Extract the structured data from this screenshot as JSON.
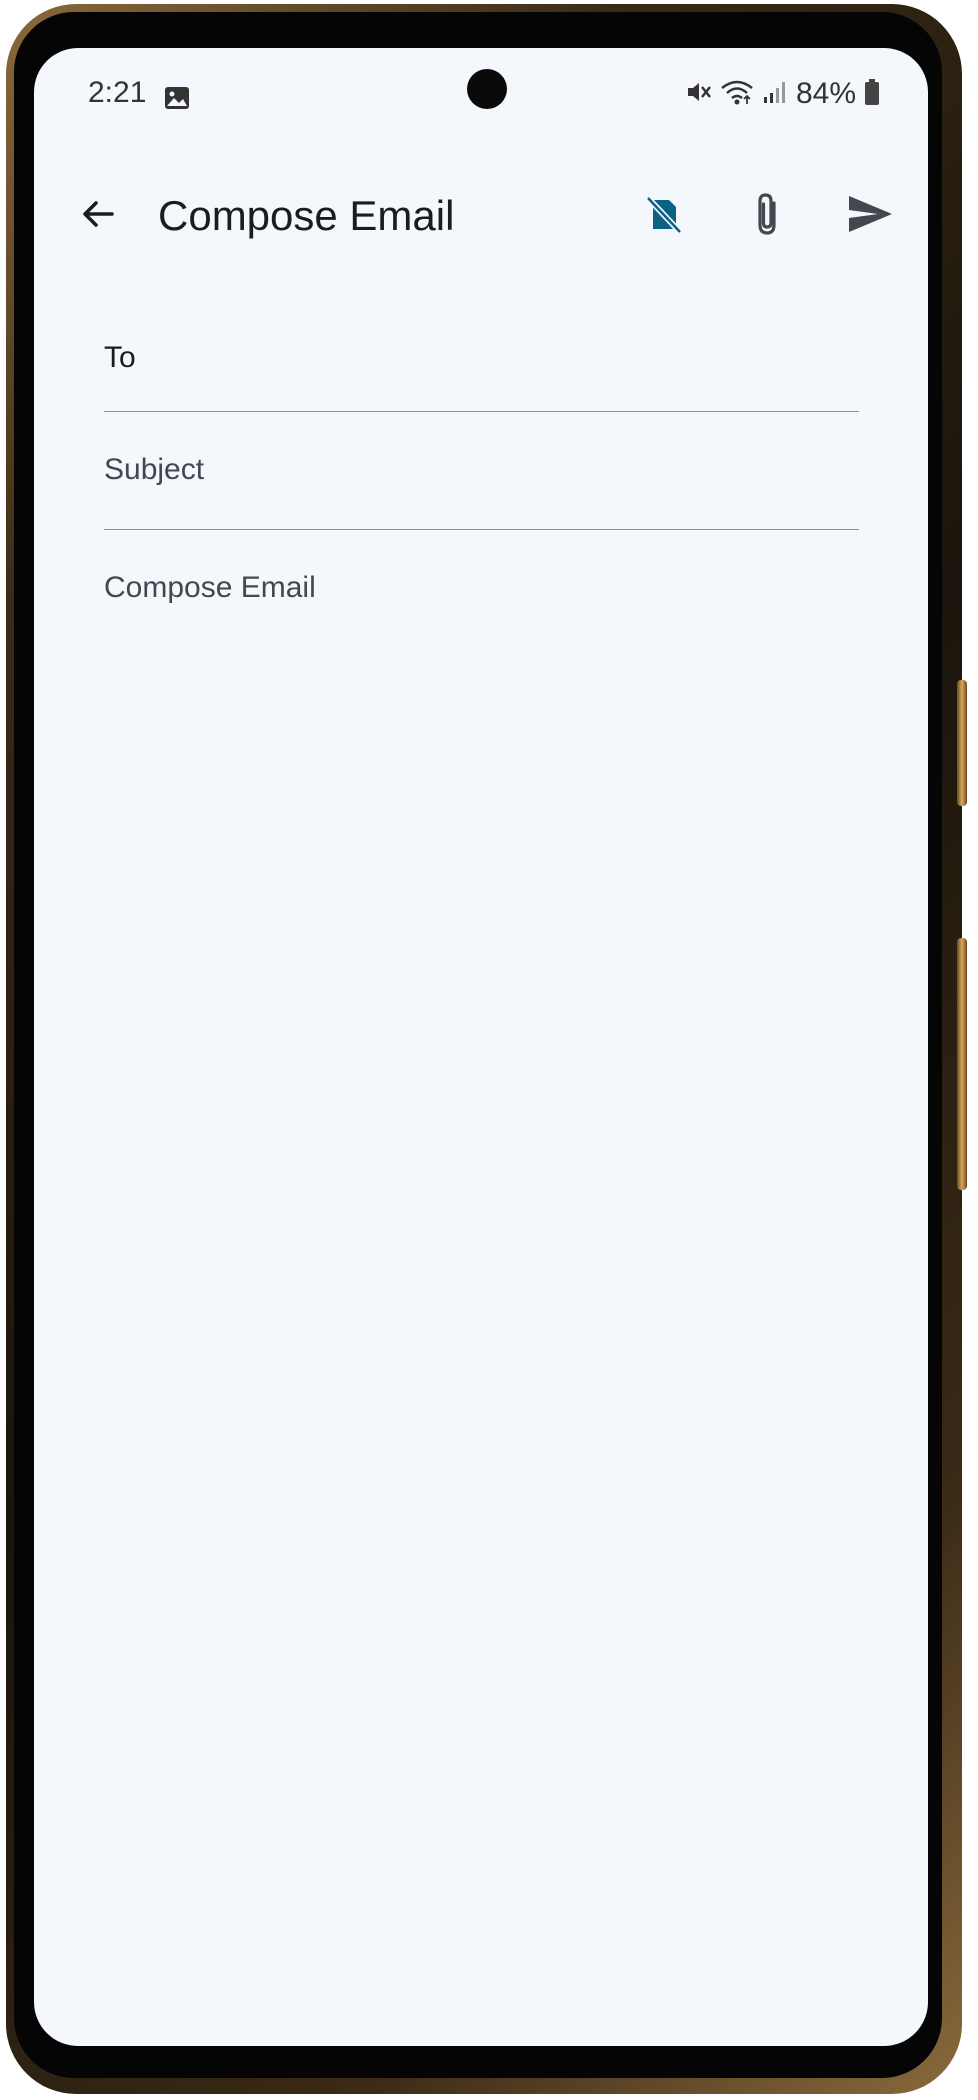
{
  "status_bar": {
    "time": "2:21",
    "battery_percent": "84%",
    "icons": [
      "image-notification-icon",
      "mute-icon",
      "wifi-icon",
      "signal-icon",
      "battery-icon"
    ]
  },
  "app_bar": {
    "title": "Compose Email",
    "back_icon": "arrow-back-icon",
    "actions": [
      {
        "icon": "sim-off-icon",
        "color": "#0b6285"
      },
      {
        "icon": "attach-icon",
        "color": "#44474e"
      },
      {
        "icon": "send-icon",
        "color": "#44474e"
      }
    ]
  },
  "form": {
    "to": {
      "label": "To",
      "value": ""
    },
    "subject": {
      "placeholder": "Subject",
      "value": ""
    },
    "body": {
      "placeholder": "Compose Email",
      "value": ""
    }
  },
  "colors": {
    "background": "#f4f7fc",
    "accent": "#0b6285",
    "divider": "#8c9199"
  }
}
